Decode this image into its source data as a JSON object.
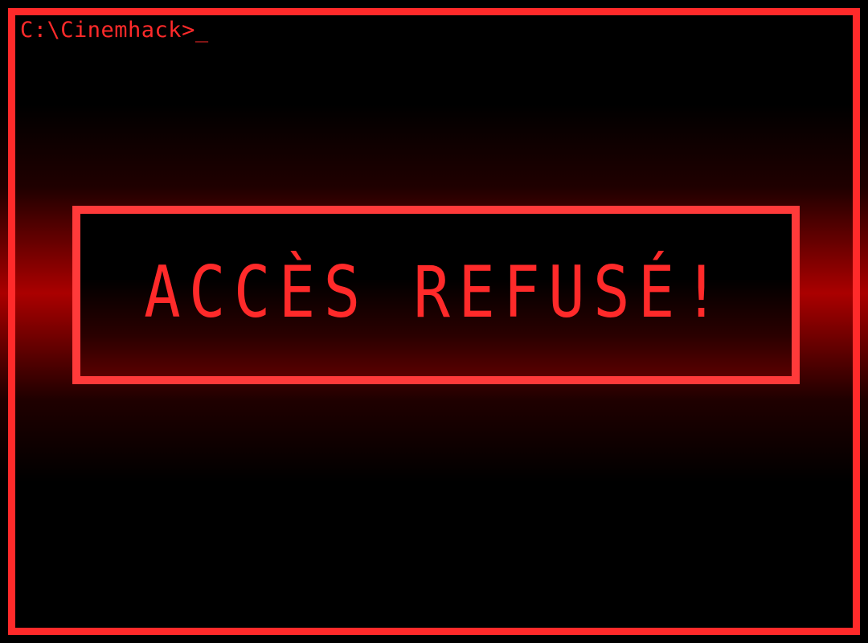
{
  "terminal": {
    "prompt": "C:\\Cinemhack>_"
  },
  "alert": {
    "message": "ACCÈS REFUSÉ!"
  },
  "colors": {
    "accent": "#ff2a2a",
    "background": "#000000",
    "glow": "#c80000"
  }
}
